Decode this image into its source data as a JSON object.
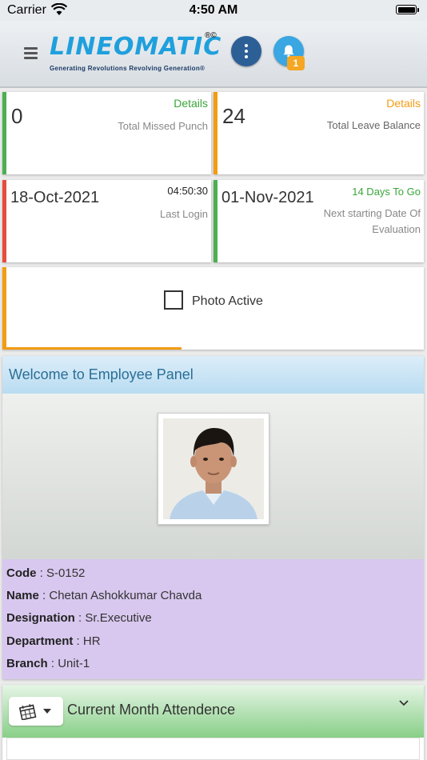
{
  "status_bar": {
    "carrier": "Carrier",
    "time": "4:50 AM"
  },
  "header": {
    "logo_text": "LINEOMATIC",
    "logo_mark": "®©",
    "logo_tagline": "Generating Revolutions Revolving Generation®",
    "notification_count": "1",
    "colors": {
      "more_button": "#2d5f97",
      "bell_button": "#3aa6e2",
      "badge": "#f5a623"
    }
  },
  "cards": {
    "missed_punch": {
      "value": "0",
      "link": "Details",
      "label": "Total Missed Punch",
      "accent": "#4caf50",
      "link_color": "#3aa63a"
    },
    "leave_balance": {
      "value": "24",
      "link": "Details",
      "label": "Total Leave Balance",
      "accent": "#f39c12",
      "link_color": "#f39c12"
    },
    "last_login": {
      "value": "18-Oct-2021",
      "time": "04:50:30",
      "label": "Last Login",
      "accent": "#e74c3c"
    },
    "evaluation": {
      "value": "01-Nov-2021",
      "link": "14 Days To Go",
      "label_line1": "Next starting Date Of",
      "label_line2": "Evaluation",
      "accent": "#4caf50",
      "link_color": "#3aa63a"
    }
  },
  "photo_active": {
    "label": "Photo Active",
    "checked": false,
    "progress": 0.42
  },
  "employee_panel": {
    "title": "Welcome to Employee Panel",
    "fields": [
      {
        "key": "Code",
        "value": "S-0152"
      },
      {
        "key": "Name",
        "value": "Chetan Ashokkumar Chavda"
      },
      {
        "key": "Designation",
        "value": "Sr.Executive"
      },
      {
        "key": "Department",
        "value": "HR"
      },
      {
        "key": "Branch",
        "value": "Unit-1"
      }
    ]
  },
  "attendance": {
    "title": "Current Month Attendence",
    "calendar_icon": "calendar-icon",
    "expand_icon": "chevron-down-icon"
  }
}
